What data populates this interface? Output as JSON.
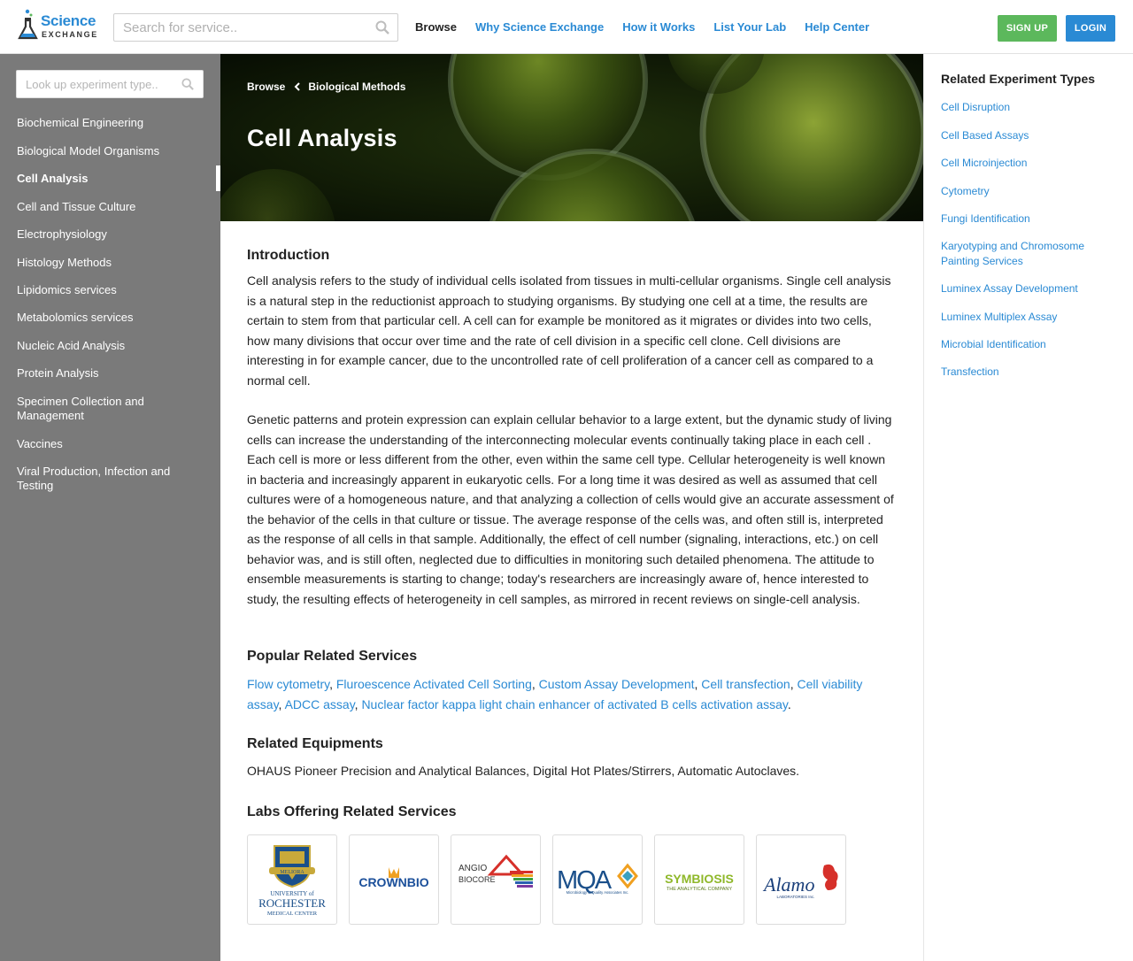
{
  "header": {
    "logo_line1": "Science",
    "logo_line2": "EXCHANGE",
    "search_placeholder": "Search for service..",
    "nav": [
      "Browse",
      "Why Science Exchange",
      "How it Works",
      "List Your Lab",
      "Help Center"
    ],
    "signup_label": "SIGN UP",
    "login_label": "LOGIN"
  },
  "sidebar": {
    "search_placeholder": "Look up experiment type..",
    "items": [
      "Biochemical Engineering",
      "Biological Model Organisms",
      "Cell Analysis",
      "Cell and Tissue Culture",
      "Electrophysiology",
      "Histology Methods",
      "Lipidomics services",
      "Metabolomics services",
      "Nucleic Acid Analysis",
      "Protein Analysis",
      "Specimen Collection and Management",
      "Vaccines",
      "Viral Production, Infection and Testing"
    ],
    "active_index": 2
  },
  "hero": {
    "breadcrumb_root": "Browse",
    "breadcrumb_parent": "Biological Methods",
    "title": "Cell Analysis"
  },
  "main": {
    "intro_heading": "Introduction",
    "intro_p1": "Cell analysis refers to the study of individual cells isolated from tissues in multi-cellular organisms. Single cell analysis is a natural step in the reductionist approach to studying organisms. By studying one cell at a time, the results are certain to stem from that particular cell. A cell can for example be monitored as it migrates or divides into two cells, how many divisions that occur over time and the rate of cell division in a specific cell clone. Cell divisions are interesting in for example cancer, due to the uncontrolled rate of cell proliferation of a cancer cell as compared to a normal cell.",
    "intro_p2": "Genetic patterns and protein expression can explain cellular behavior to a large extent, but the dynamic study of living cells can increase the understanding of the interconnecting molecular events continually taking place in each cell . Each cell is more or less different from the other, even within the same cell type. Cellular heterogeneity is well known in bacteria and increasingly apparent in eukaryotic cells. For a long time it was desired as well as assumed that cell cultures were of a homogeneous nature, and that analyzing a collection of cells would give an accurate assessment of the behavior of the cells in that culture or tissue. The average response of the cells was, and often still is, interpreted as the response of all cells in that sample. Additionally, the effect of cell number (signaling, interactions, etc.) on cell behavior was, and is still often, neglected due to difficulties in monitoring such detailed phenomena. The attitude to ensemble measurements is starting to change; today's researchers are increasingly aware of, hence interested to study, the resulting effects of heterogeneity in cell samples, as mirrored in recent reviews on single-cell analysis.",
    "services_heading": "Popular Related Services",
    "services": [
      "Flow cytometry",
      "Fluroescence Activated Cell Sorting",
      "Custom Assay Development",
      "Cell transfection",
      "Cell viability assay",
      "ADCC assay",
      "Nuclear factor kappa light chain enhancer of activated B cells activation assay"
    ],
    "equipment_heading": "Related Equipments",
    "equipment_text": "OHAUS Pioneer Precision and Analytical Balances, Digital Hot Plates/Stirrers, Automatic Autoclaves.",
    "labs_heading": "Labs Offering Related Services",
    "labs": [
      {
        "name": "university-of-rochester",
        "line1": "UNIVERSITY of",
        "line2": "ROCHESTER",
        "line3": "MEDICAL CENTER",
        "motto": "MELIORA"
      },
      {
        "name": "crownbio",
        "line1": "CROWNBIO"
      },
      {
        "name": "angio-biocore",
        "line1": "ANGIO",
        "line2": "BIOCORE"
      },
      {
        "name": "mqa",
        "line1": "MQA",
        "line2": "Microbiology & Quality Associates Inc."
      },
      {
        "name": "symbiosis",
        "line1": "SYMBIOSIS",
        "line2": "THE ANALYTICAL COMPANY"
      },
      {
        "name": "alamo",
        "line1": "Alamo",
        "line2": "LABORATORIES Inc."
      }
    ]
  },
  "right": {
    "heading": "Related Experiment Types",
    "items": [
      "Cell Disruption",
      "Cell Based Assays",
      "Cell Microinjection",
      "Cytometry",
      "Fungi Identification",
      "Karyotyping and Chromosome Painting Services",
      "Luminex Assay Development",
      "Luminex Multiplex Assay",
      "Microbial Identification",
      "Transfection"
    ]
  },
  "colors": {
    "link": "#2a8ad4",
    "signup": "#5cb85c",
    "login": "#2a8ad4",
    "sidebar": "#7a7a7a"
  }
}
